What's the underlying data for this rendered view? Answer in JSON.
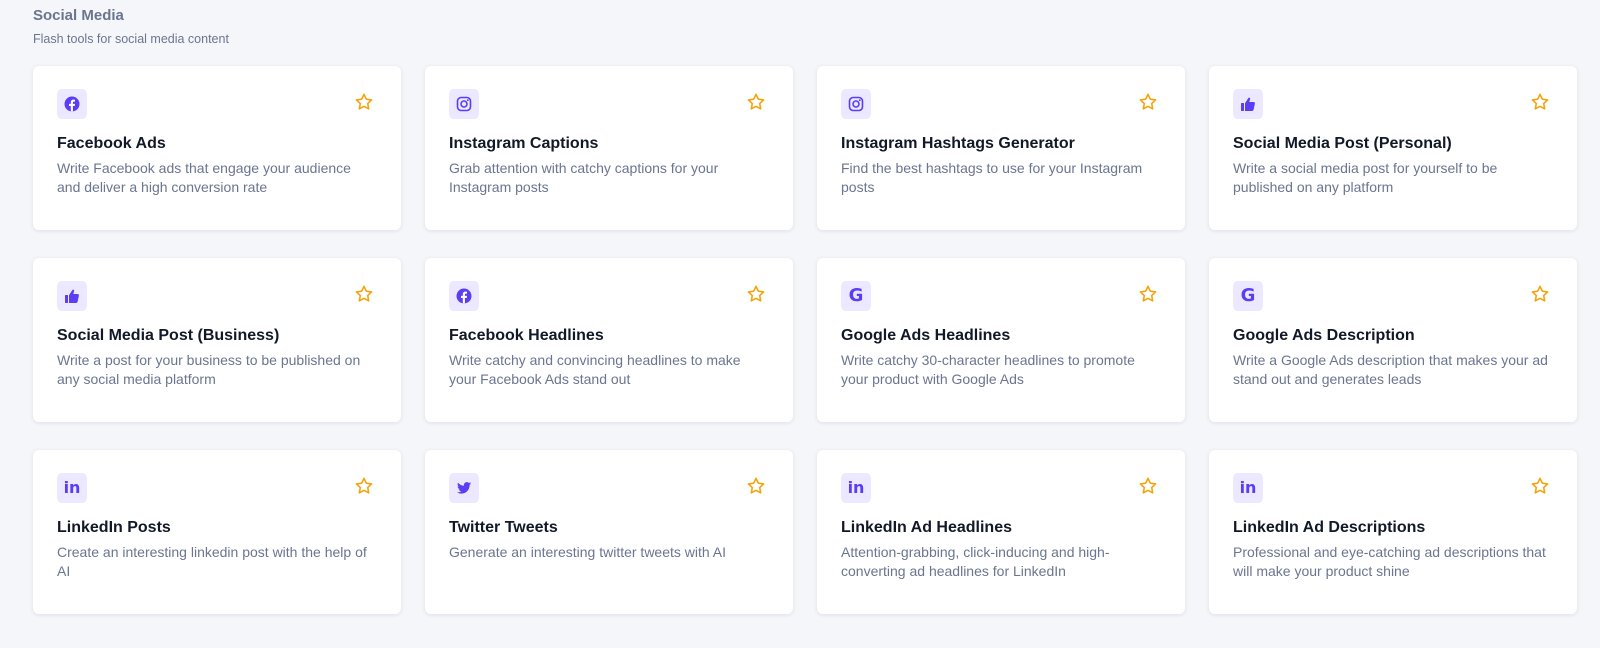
{
  "section": {
    "title": "Social Media",
    "subtitle": "Flash tools for social media content"
  },
  "colors": {
    "accent": "#5b3df5",
    "icon_bg": "#ebe8ff",
    "star": "#f5a30b",
    "title": "#111827",
    "muted": "#6b7590",
    "page_bg": "#f4f6f9"
  },
  "cards": [
    {
      "icon": "facebook-icon",
      "title": "Facebook Ads",
      "description": "Write Facebook ads that engage your audience and deliver a high conversion rate"
    },
    {
      "icon": "instagram-icon",
      "title": "Instagram Captions",
      "description": "Grab attention with catchy captions for your Instagram posts"
    },
    {
      "icon": "instagram-icon",
      "title": "Instagram Hashtags Generator",
      "description": "Find the best hashtags to use for your Instagram posts"
    },
    {
      "icon": "thumbs-up-icon",
      "title": "Social Media Post (Personal)",
      "description": "Write a social media post for yourself to be published on any platform"
    },
    {
      "icon": "thumbs-up-icon",
      "title": "Social Media Post (Business)",
      "description": "Write a post for your business to be published on any social media platform"
    },
    {
      "icon": "facebook-icon",
      "title": "Facebook Headlines",
      "description": "Write catchy and convincing headlines to make your Facebook Ads stand out"
    },
    {
      "icon": "google-icon",
      "title": "Google Ads Headlines",
      "description": "Write catchy 30-character headlines to promote your product with Google Ads"
    },
    {
      "icon": "google-icon",
      "title": "Google Ads Description",
      "description": "Write a Google Ads description that makes your ad stand out and generates leads"
    },
    {
      "icon": "linkedin-icon",
      "title": "LinkedIn Posts",
      "description": "Create an interesting linkedin post with the help of AI"
    },
    {
      "icon": "twitter-icon",
      "title": "Twitter Tweets",
      "description": "Generate an interesting twitter tweets with AI"
    },
    {
      "icon": "linkedin-icon",
      "title": "LinkedIn Ad Headlines",
      "description": "Attention-grabbing, click-inducing and high-converting ad headlines for LinkedIn"
    },
    {
      "icon": "linkedin-icon",
      "title": "LinkedIn Ad Descriptions",
      "description": "Professional and eye-catching ad descriptions that will make your product shine"
    }
  ]
}
